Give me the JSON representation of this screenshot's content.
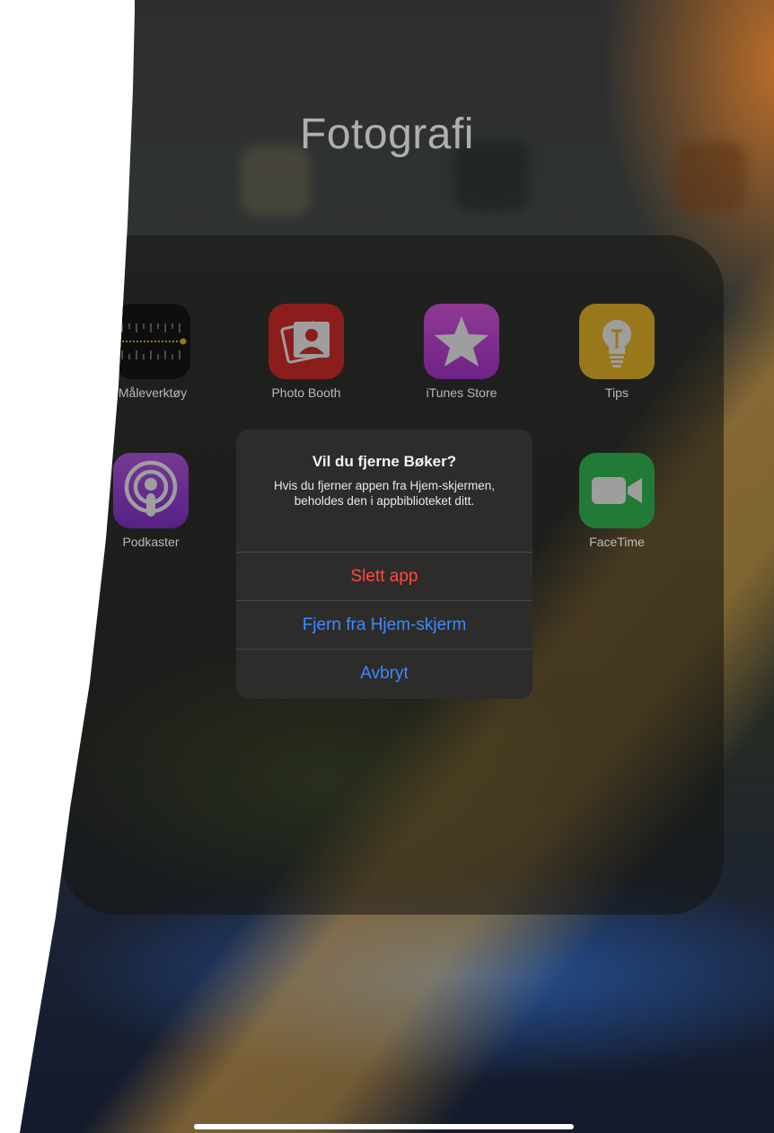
{
  "folder": {
    "title": "Fotografi"
  },
  "apps": [
    {
      "label": "Måleverktøy",
      "icon": "measure-icon",
      "color": "#1c1c1c"
    },
    {
      "label": "Photo Booth",
      "icon": "photo-booth-icon",
      "color": "#d0302c"
    },
    {
      "label": "iTunes Store",
      "icon": "star-icon",
      "color": "#d64ae0"
    },
    {
      "label": "Tips",
      "icon": "lightbulb-icon",
      "color": "#f6c52a"
    },
    {
      "label": "Podkaster",
      "icon": "podcast-icon",
      "color": "#9b44e0"
    },
    {
      "label": "FaceTime",
      "icon": "video-camera-icon",
      "color": "#35c759"
    }
  ],
  "alert": {
    "title": "Vil du fjerne Bøker?",
    "message": "Hvis du fjerner appen fra Hjem-skjermen, beholdes den i appbiblioteket ditt.",
    "buttons": {
      "delete": "Slett app",
      "remove": "Fjern fra Hjem-skjerm",
      "cancel": "Avbryt"
    }
  },
  "colors": {
    "destructive": "#ff4a3d",
    "action": "#3b8cff"
  }
}
